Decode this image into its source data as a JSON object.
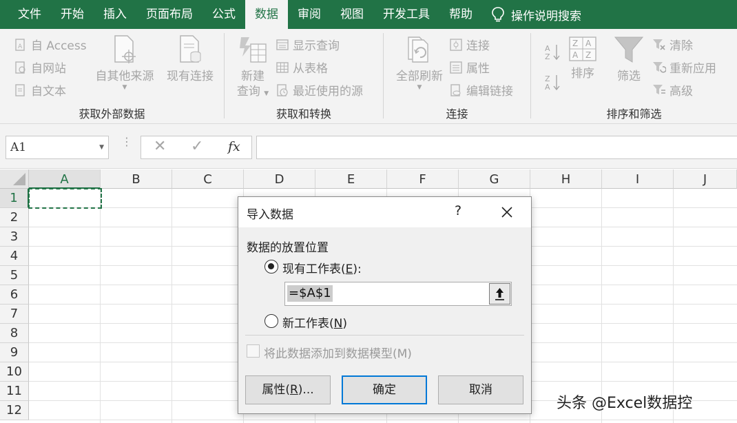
{
  "menubar": {
    "tabs": [
      {
        "label": "文件"
      },
      {
        "label": "开始"
      },
      {
        "label": "插入"
      },
      {
        "label": "页面布局"
      },
      {
        "label": "公式"
      },
      {
        "label": "数据"
      },
      {
        "label": "审阅"
      },
      {
        "label": "视图"
      },
      {
        "label": "开发工具"
      },
      {
        "label": "帮助"
      }
    ],
    "active_tab": "数据",
    "tell_me": "操作说明搜索",
    "tell_me_icon": "lightbulb-icon",
    "background_color": "#217346"
  },
  "ribbon": {
    "external": {
      "label": "获取外部数据",
      "access": "自 Access",
      "web": "自网站",
      "text": "自文本",
      "other": "自其他来源",
      "existing": "现有连接"
    },
    "transform": {
      "label": "获取和转换",
      "new_query_line1": "新建",
      "new_query_line2": "查询",
      "show_queries": "显示查询",
      "from_table": "从表格",
      "recent_sources": "最近使用的源"
    },
    "connections": {
      "label": "连接",
      "refresh_all": "全部刷新",
      "connections": "连接",
      "properties": "属性",
      "edit_links": "编辑链接"
    },
    "sortfilter": {
      "label": "排序和筛选",
      "sort": "排序",
      "filter": "筛选",
      "clear": "清除",
      "reapply": "重新应用",
      "advanced": "高级"
    }
  },
  "formula_bar": {
    "name_box": "A1",
    "fx": "fx",
    "formula": ""
  },
  "sheet": {
    "columns": [
      "A",
      "B",
      "C",
      "D",
      "E",
      "F",
      "G",
      "H",
      "I",
      "J"
    ],
    "rows": [
      "1",
      "2",
      "3",
      "4",
      "5",
      "6",
      "7",
      "8",
      "9",
      "10",
      "11",
      "12"
    ],
    "selected_cell": "A1"
  },
  "dialog": {
    "title": "导入数据",
    "help": "?",
    "section": "数据的放置位置",
    "existing_sheet": {
      "text": "现有工作表(",
      "key": "E",
      "suffix": "):",
      "checked": true
    },
    "reference": "=$A$1",
    "new_sheet": {
      "text": "新工作表(",
      "key": "N",
      "suffix": ")",
      "checked": false
    },
    "add_to_model": {
      "label": "将此数据添加到数据模型(M)",
      "checked": false,
      "enabled": false
    },
    "properties": {
      "text": "属性(",
      "key": "R",
      "suffix": ")..."
    },
    "ok": "确定",
    "cancel": "取消"
  },
  "watermark": "头条 @Excel数据控"
}
